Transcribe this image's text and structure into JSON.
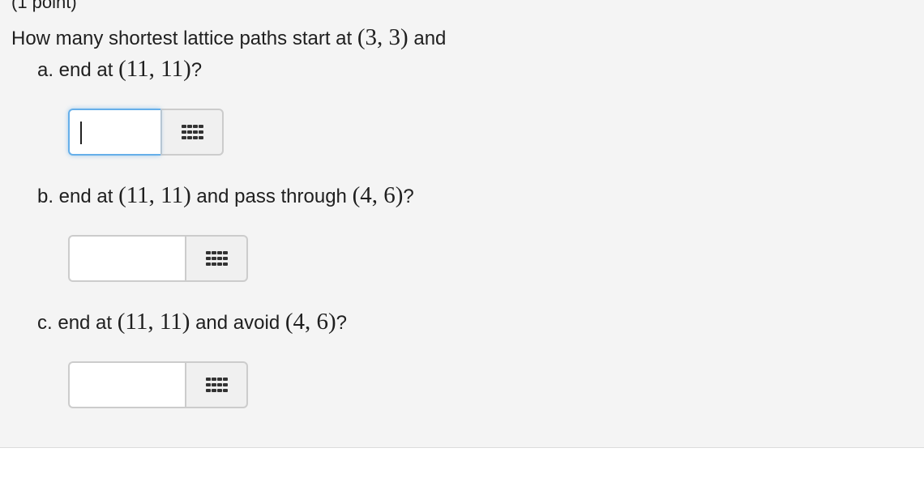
{
  "points_label": "(1 point)",
  "question": {
    "prefix": "How many shortest lattice paths start at ",
    "start_point": "(3, 3)",
    "suffix": " and"
  },
  "parts": [
    {
      "letter": "a.",
      "text_before": " end at ",
      "end_point": "(11, 11)",
      "text_after": "?",
      "condition_point": "",
      "answer_value": "",
      "focused": true
    },
    {
      "letter": "b.",
      "text_before": " end at ",
      "end_point": "(11, 11)",
      "text_middle": " and pass through ",
      "condition_point": "(4, 6)",
      "text_after": "?",
      "answer_value": "",
      "focused": false
    },
    {
      "letter": "c.",
      "text_before": " end at ",
      "end_point": "(11, 11)",
      "text_middle": " and avoid ",
      "condition_point": "(4, 6)",
      "text_after": "?",
      "answer_value": "",
      "focused": false
    }
  ],
  "icons": {
    "palette": "equation-palette-grid-icon"
  }
}
